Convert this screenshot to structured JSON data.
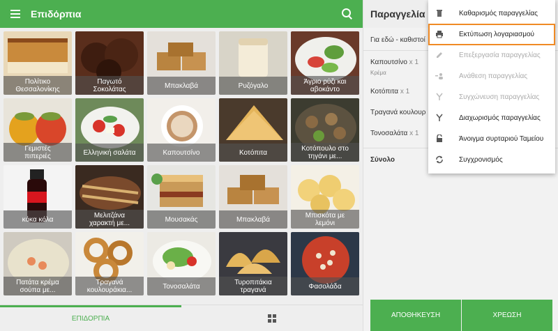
{
  "app": {
    "title": "Επιδόρπια"
  },
  "products": [
    {
      "label": "Πολίτικο\nΘεσσαλονίκης"
    },
    {
      "label": "Παγωτό\nΣοκολάτας"
    },
    {
      "label": "Μπακλαβά"
    },
    {
      "label": "Ρυζόγαλο"
    },
    {
      "label": "Άγριο ρύζι και\nαβοκάντο"
    },
    {
      "label": "Γεμιστές\nπιπεριές"
    },
    {
      "label": "Ελληνική σαλάτα"
    },
    {
      "label": "Καπουτσίνο"
    },
    {
      "label": "Κοτόπιτα"
    },
    {
      "label": "Κοτόπουλο στο\nτηγάνι με..."
    },
    {
      "label": "κόκα κόλα"
    },
    {
      "label": "Μελιτζάνα\nχαρακτή με..."
    },
    {
      "label": "Μουσακάς"
    },
    {
      "label": "Μπακλαβά"
    },
    {
      "label": "Μπισκότα με\nλεμόνι"
    },
    {
      "label": "Πατάτα κρέμα\nσούπα με..."
    },
    {
      "label": "Τραγανά\nκουλουράκια..."
    },
    {
      "label": "Τονοσαλάτα"
    },
    {
      "label": "Τυροπιτάκια\nτραγανά"
    },
    {
      "label": "Φασολάδα"
    }
  ],
  "bottom_tabs": {
    "category_label": "ΕΠΙΔΟΡΠΙΑ"
  },
  "order": {
    "title": "Παραγγελία",
    "type": "Για εδώ - καθιστοί",
    "items": [
      {
        "name": "Καπουτσίνο",
        "qty": "x 1",
        "note": "Κρέμα"
      },
      {
        "name": "Κοτόπιτα",
        "qty": "x 1",
        "note": ""
      },
      {
        "name": "Τραγανά κουλουρ",
        "qty": "",
        "note": ""
      },
      {
        "name": "Τονοσαλάτα",
        "qty": "x 1",
        "note": ""
      }
    ],
    "total_label": "Σύνολο",
    "save_label": "ΑΠΟΘΗΚΕΥΣΗ",
    "charge_label": "ΧΡΕΩΣΗ"
  },
  "menu": {
    "items": [
      {
        "label": "Καθαρισμός παραγγελίας",
        "icon": "trash-icon",
        "enabled": true
      },
      {
        "label": "Εκτύπωση λογαριασμού",
        "icon": "printer-icon",
        "enabled": true
      },
      {
        "label": "Επεξεργασία παραγγελίας",
        "icon": "pencil-icon",
        "enabled": false
      },
      {
        "label": "Ανάθεση παραγγελίας",
        "icon": "assign-icon",
        "enabled": false
      },
      {
        "label": "Συγχώνευση παραγγελίας",
        "icon": "merge-icon",
        "enabled": false
      },
      {
        "label": "Διαχωρισμός παραγγελίας",
        "icon": "split-icon",
        "enabled": true
      },
      {
        "label": "Άνοιγμα συρταριού Ταμείου",
        "icon": "unlock-icon",
        "enabled": true
      },
      {
        "label": "Συγχρονισμός",
        "icon": "sync-icon",
        "enabled": true
      }
    ]
  },
  "colors": {
    "primary": "#4caf50",
    "highlight": "#f08a24"
  }
}
